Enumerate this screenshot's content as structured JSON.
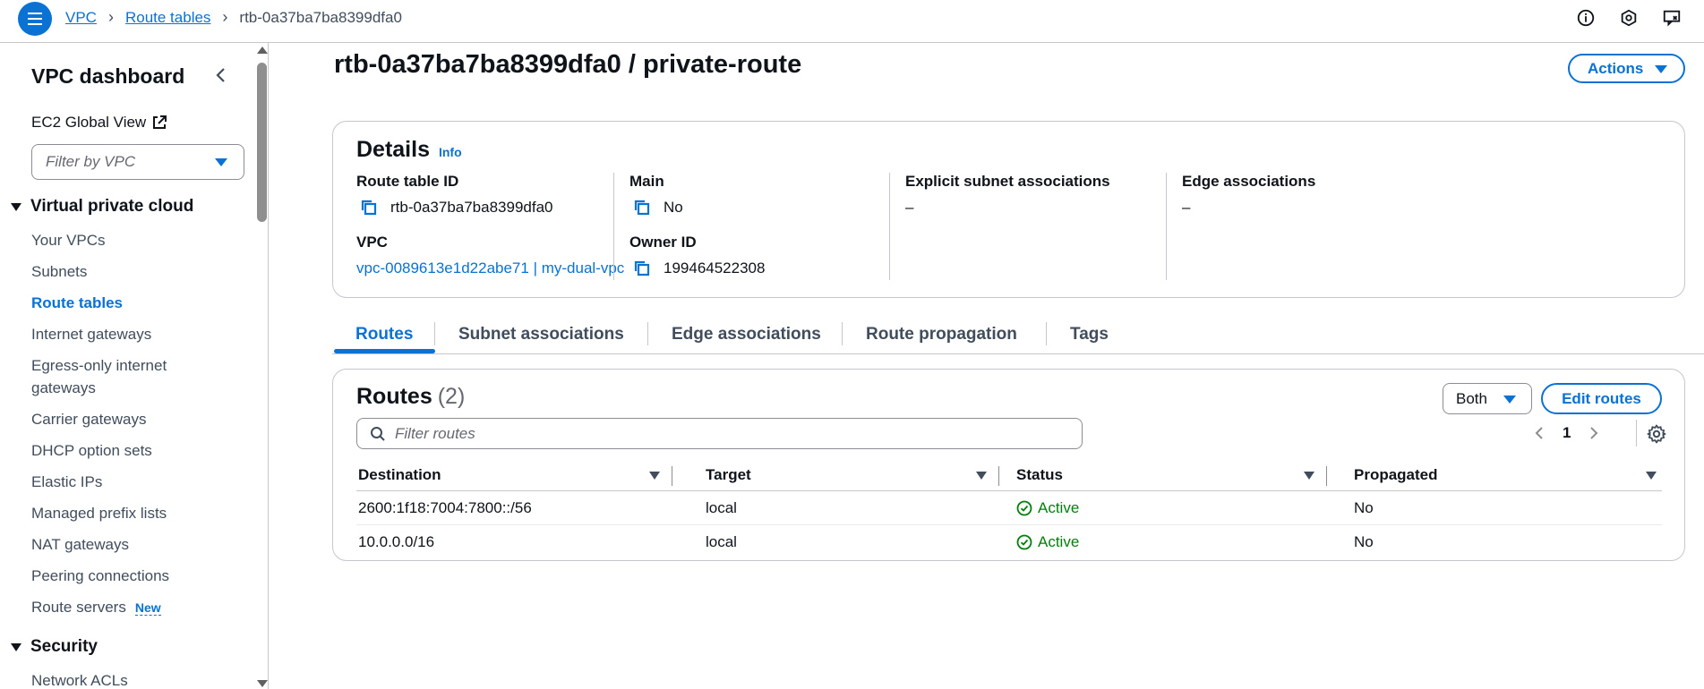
{
  "breadcrumb": {
    "items": [
      {
        "label": "VPC"
      },
      {
        "label": "Route tables"
      }
    ],
    "current": "rtb-0a37ba7ba8399dfa0"
  },
  "top_icons": [
    "info-icon",
    "settings-hex-icon",
    "feedback-icon"
  ],
  "sidebar": {
    "title": "VPC dashboard",
    "ec2_link": "EC2 Global View",
    "filter_placeholder": "Filter by VPC",
    "section_vpc": "Virtual private cloud",
    "items": [
      {
        "label": "Your VPCs"
      },
      {
        "label": "Subnets"
      },
      {
        "label": "Route tables",
        "active": true
      },
      {
        "label": "Internet gateways"
      },
      {
        "label": "Egress-only internet gateways"
      },
      {
        "label": "Carrier gateways"
      },
      {
        "label": "DHCP option sets"
      },
      {
        "label": "Elastic IPs"
      },
      {
        "label": "Managed prefix lists"
      },
      {
        "label": "NAT gateways"
      },
      {
        "label": "Peering connections"
      },
      {
        "label": "Route servers",
        "badge": "New"
      }
    ],
    "section_security": "Security",
    "security_items": [
      {
        "label": "Network ACLs"
      }
    ]
  },
  "page": {
    "title": "rtb-0a37ba7ba8399dfa0 / private-route",
    "actions_label": "Actions"
  },
  "details": {
    "heading": "Details",
    "info_label": "Info",
    "route_table_id_label": "Route table ID",
    "route_table_id": "rtb-0a37ba7ba8399dfa0",
    "vpc_label": "VPC",
    "vpc_value": "vpc-0089613e1d22abe71 | my-dual-vpc",
    "main_label": "Main",
    "main_value": "No",
    "owner_label": "Owner ID",
    "owner_value": "199464522308",
    "explicit_label": "Explicit subnet associations",
    "explicit_value": "–",
    "edge_label": "Edge associations",
    "edge_value": "–"
  },
  "tabs": [
    {
      "label": "Routes",
      "active": true
    },
    {
      "label": "Subnet associations"
    },
    {
      "label": "Edge associations"
    },
    {
      "label": "Route propagation"
    },
    {
      "label": "Tags"
    }
  ],
  "routes": {
    "heading": "Routes",
    "count": "(2)",
    "filter_select": "Both",
    "edit_label": "Edit routes",
    "filter_placeholder": "Filter routes",
    "page_number": "1",
    "columns": [
      "Destination",
      "Target",
      "Status",
      "Propagated"
    ],
    "rows": [
      {
        "destination": "2600:1f18:7004:7800::/56",
        "target": "local",
        "status": "Active",
        "propagated": "No"
      },
      {
        "destination": "10.0.0.0/16",
        "target": "local",
        "status": "Active",
        "propagated": "No"
      }
    ]
  },
  "colors": {
    "accent": "#0972d3",
    "success": "#037f0c",
    "text": "#0f141a",
    "border": "#c6c6cd"
  }
}
